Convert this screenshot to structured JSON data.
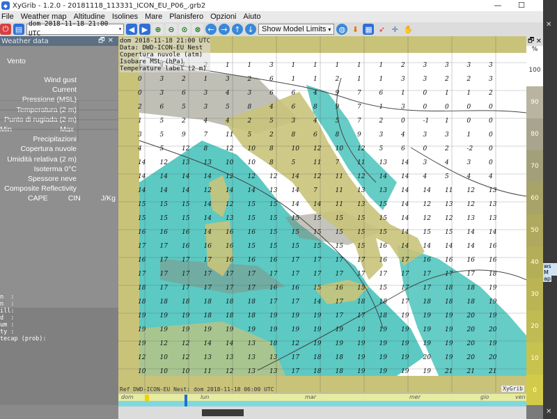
{
  "window": {
    "title": "XyGrib - 1.2.0 - 20181118_113331_ICON_EU_P06_.grb2",
    "min": "—",
    "max": "☐",
    "close": "✕"
  },
  "menu": [
    "File",
    "Weather map",
    "Altitudine",
    "Isolines",
    "Mare",
    "Planisfero",
    "Opzioni",
    "Aiuto"
  ],
  "toolbar": {
    "date": "dom 2018-11-18 21:00 UTC",
    "model_limits": "Show Model Limits"
  },
  "leftpanel": {
    "title": "Weather data",
    "rows": {
      "vento": "Vento",
      "wind_gust": "Wind gust",
      "current": "Current",
      "pressione": "Pressione (MSL)",
      "temperatura": "Temperatura (2 m)",
      "rugiada": "Punto di rugiada (2 m)",
      "min": "Min",
      "max": "Max",
      "precipitazioni": "Precipitazioni",
      "copertura": "Copertura nuvole",
      "umidita": "Umidità relativa (2 m)",
      "isoterma": "Isoterma 0°C",
      "neve": "Spessore neve",
      "reflectivity": "Composite Reflectivity",
      "cape": "CAPE",
      "cin": "CIN",
      "jkg": "J/Kg"
    },
    "mono": "n  :\nn  :\nill:\nd  :\num :\nty :\ntecap (prob):"
  },
  "map": {
    "info": [
      "dom 2018-11-18 21:00 UTC",
      "Data: DWD-ICON-EU Nest",
      "Copertura nuvole (atm)",
      "Isobare MSL (hPa)",
      "Temperature label (2 m)"
    ],
    "ref": "Ref DWD-ICON-EU Nest: dom 2018-11-18 06:00 UTC",
    "brand": "XyGrib",
    "temp_grid": [
      [
        1,
        4,
        1,
        2,
        1,
        1,
        3,
        1,
        1,
        1,
        1,
        1,
        2,
        3,
        3,
        3,
        3
      ],
      [
        0,
        3,
        2,
        1,
        3,
        2,
        6,
        1,
        1,
        2,
        1,
        1,
        3,
        3,
        2,
        2,
        3
      ],
      [
        0,
        3,
        6,
        3,
        4,
        3,
        6,
        6,
        4,
        9,
        7,
        6,
        1,
        0,
        1,
        1,
        2
      ],
      [
        2,
        6,
        5,
        3,
        5,
        8,
        4,
        6,
        8,
        9,
        7,
        1,
        3,
        0,
        0,
        0,
        0
      ],
      [
        1,
        5,
        2,
        4,
        4,
        2,
        5,
        3,
        4,
        5,
        7,
        2,
        0,
        -1,
        1,
        0,
        0
      ],
      [
        3,
        5,
        9,
        7,
        11,
        5,
        2,
        8,
        6,
        8,
        9,
        3,
        4,
        3,
        3,
        1,
        0
      ],
      [
        4,
        5,
        12,
        8,
        12,
        10,
        8,
        10,
        12,
        10,
        12,
        5,
        6,
        0,
        2,
        -2,
        0
      ],
      [
        14,
        12,
        13,
        13,
        10,
        10,
        8,
        5,
        11,
        7,
        11,
        13,
        14,
        3,
        4,
        3,
        0
      ],
      [
        14,
        14,
        14,
        14,
        12,
        12,
        12,
        14,
        12,
        11,
        12,
        14,
        14,
        4,
        5,
        4,
        4
      ],
      [
        14,
        14,
        14,
        12,
        14,
        14,
        13,
        14,
        7,
        11,
        13,
        13,
        14,
        14,
        11,
        12,
        13
      ],
      [
        15,
        15,
        15,
        14,
        12,
        15,
        15,
        14,
        14,
        11,
        13,
        15,
        14,
        12,
        13,
        12,
        13
      ],
      [
        15,
        15,
        15,
        14,
        13,
        15,
        15,
        15,
        15,
        15,
        15,
        15,
        14,
        12,
        12,
        13,
        13
      ],
      [
        16,
        16,
        16,
        14,
        16,
        16,
        15,
        15,
        15,
        15,
        15,
        15,
        14,
        15,
        15,
        14,
        14
      ],
      [
        17,
        17,
        16,
        16,
        16,
        15,
        15,
        15,
        15,
        15,
        15,
        16,
        14,
        14,
        14,
        14,
        16
      ],
      [
        16,
        17,
        17,
        17,
        16,
        16,
        16,
        17,
        17,
        17,
        17,
        16,
        17,
        16,
        16,
        16,
        16
      ],
      [
        17,
        17,
        17,
        17,
        17,
        17,
        17,
        17,
        17,
        17,
        17,
        17,
        17,
        17,
        17,
        17,
        18
      ],
      [
        18,
        17,
        17,
        17,
        17,
        17,
        16,
        16,
        15,
        16,
        15,
        15,
        17,
        17,
        18,
        18,
        19
      ],
      [
        18,
        18,
        18,
        18,
        18,
        18,
        17,
        17,
        14,
        17,
        18,
        18,
        17,
        18,
        18,
        18,
        19
      ],
      [
        19,
        19,
        19,
        18,
        18,
        18,
        19,
        19,
        19,
        17,
        17,
        18,
        19,
        19,
        19,
        20,
        19
      ],
      [
        19,
        19,
        19,
        19,
        19,
        19,
        19,
        19,
        19,
        19,
        19,
        19,
        19,
        19,
        19,
        20,
        20
      ],
      [
        19,
        12,
        12,
        14,
        14,
        13,
        18,
        12,
        19,
        19,
        19,
        19,
        19,
        19,
        19,
        20,
        19
      ],
      [
        12,
        10,
        12,
        13,
        13,
        13,
        13,
        17,
        18,
        18,
        19,
        19,
        19,
        20,
        19,
        20,
        20
      ],
      [
        10,
        10,
        10,
        11,
        12,
        13,
        13,
        17,
        18,
        18,
        19,
        19,
        19,
        19,
        21,
        21,
        21
      ]
    ]
  },
  "scale": {
    "unit": "%",
    "labels": [
      "100",
      "90",
      "80",
      "70",
      "60",
      "50",
      "40",
      "30",
      "20",
      "10",
      "0"
    ],
    "colors": [
      "#ffffff",
      "#b8b4a0",
      "#a9a48d",
      "#a39f78",
      "#a8a368",
      "#aea95e",
      "#b4ae58",
      "#bab454",
      "#c0bb52",
      "#c8c24e",
      "#d2cb4a"
    ]
  },
  "timeline": {
    "days": [
      "dom",
      "lun",
      "mar",
      "mer",
      "gio",
      "ven"
    ]
  },
  "side": {
    "items": [
      "ws M",
      "ap"
    ]
  }
}
